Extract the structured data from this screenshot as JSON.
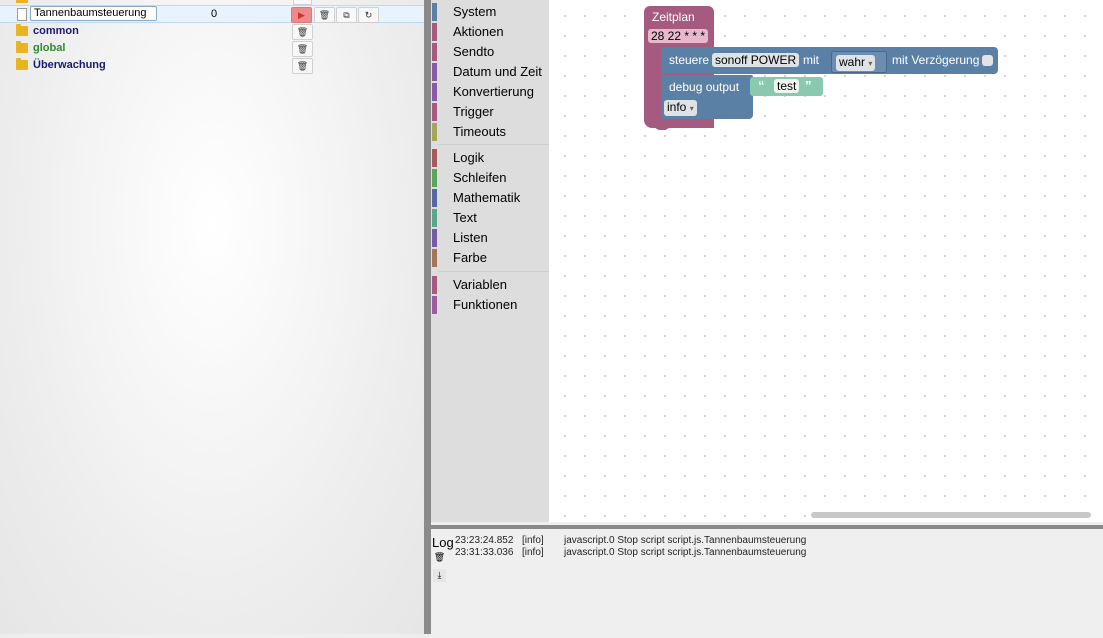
{
  "tree": {
    "items": [
      {
        "name": "Tannenbaumsteuerung",
        "count": "0"
      },
      {
        "name": "common"
      },
      {
        "name": "global"
      },
      {
        "name": "Überwachung"
      }
    ]
  },
  "toolbox": {
    "categories": [
      {
        "label": "System",
        "color": "#5b80a5"
      },
      {
        "label": "Aktionen",
        "color": "#a55b80"
      },
      {
        "label": "Sendto",
        "color": "#a55b80"
      },
      {
        "label": "Datum und Zeit",
        "color": "#8a5ba5"
      },
      {
        "label": "Konvertierung",
        "color": "#8a5ba5"
      },
      {
        "label": "Trigger",
        "color": "#a55b80"
      },
      {
        "label": "Timeouts",
        "color": "#a5a55b"
      },
      {
        "label": "Logik",
        "color": "#a55b5b"
      },
      {
        "label": "Schleifen",
        "color": "#5ba55b"
      },
      {
        "label": "Mathematik",
        "color": "#5b67a5"
      },
      {
        "label": "Text",
        "color": "#5ba58c"
      },
      {
        "label": "Listen",
        "color": "#745ba5"
      },
      {
        "label": "Farbe",
        "color": "#a5745b"
      },
      {
        "label": "Variablen",
        "color": "#a55b80"
      },
      {
        "label": "Funktionen",
        "color": "#9a5ba5"
      }
    ]
  },
  "blocks": {
    "schedule_title": "Zeitplan",
    "schedule_value": "28 22 * * *",
    "control_label": "steuere",
    "control_object": "sonoff POWER",
    "control_with": "mit",
    "control_value": "wahr",
    "control_delay": "mit Verzögerung",
    "debug_label": "debug output",
    "debug_quote_open": "“",
    "debug_text": "test",
    "debug_quote_close": "”",
    "debug_level": "info"
  },
  "log": {
    "title": "Log",
    "entries": [
      {
        "time": "23:23:24.852",
        "level": "[info]",
        "message": "javascript.0 Stop script script.js.Tannenbaumsteuerung"
      },
      {
        "time": "23:31:33.036",
        "level": "[info]",
        "message": "javascript.0 Stop script script.js.Tannenbaumsteuerung"
      }
    ]
  },
  "colors": {
    "event_block": "#a55b80",
    "control_block": "#5b80a5",
    "text_block": "#5ba58c",
    "folder": "#e8b422",
    "common_label": "#1a1a6e",
    "global_label": "#2e8b2e"
  }
}
